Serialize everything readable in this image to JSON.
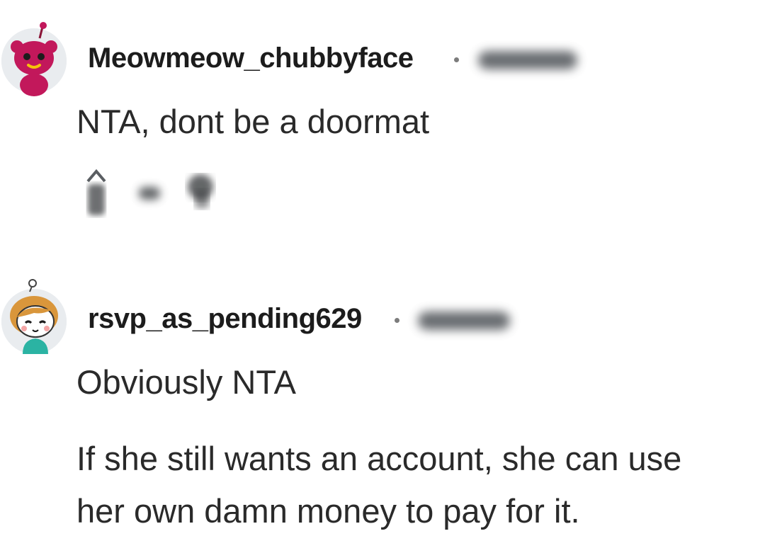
{
  "comments": [
    {
      "username": "Meowmeow_chubbyface",
      "body": "NTA, dont be a doormat",
      "avatar": "snoo-pink-avatar-icon",
      "accent": "#c2185b"
    },
    {
      "username": "rsvp_as_pending629",
      "body_paragraphs": [
        "Obviously NTA",
        "If she still wants an account, she can use",
        "her own damn money to pay for it."
      ],
      "avatar": "snoo-girl-avatar-icon",
      "accent": "#2bb3a3"
    }
  ],
  "icons": {
    "separator": "dot-separator-icon",
    "upvote": "upvote-arrow-icon",
    "reply": "reply-icon"
  }
}
